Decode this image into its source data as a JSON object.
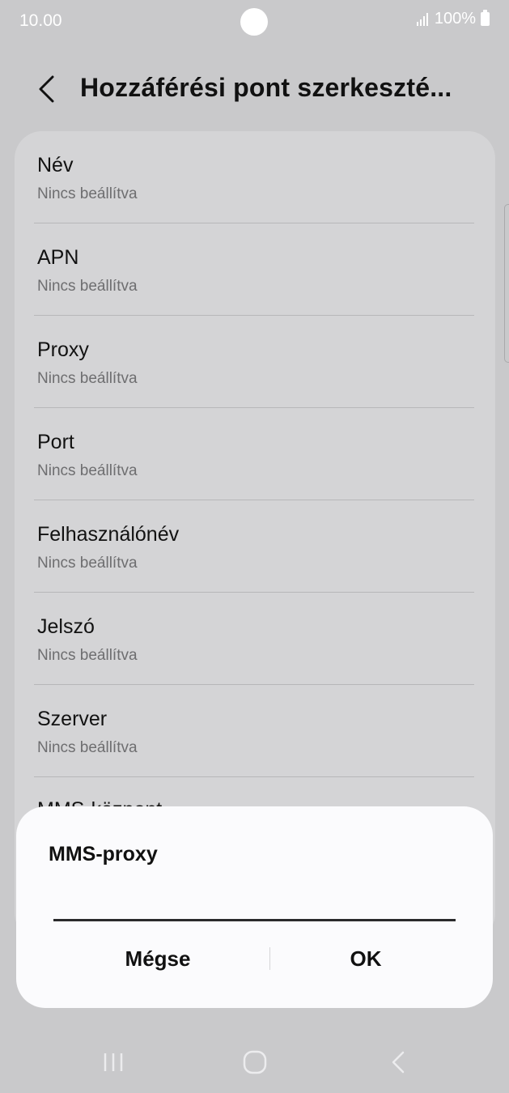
{
  "status_bar": {
    "time": "10.00",
    "battery": "100%",
    "icons": [
      "signal-icon",
      "battery-icon"
    ]
  },
  "header": {
    "back_icon": "chevron-left-icon",
    "title": "Hozzáférési pont szerkeszté..."
  },
  "settings_list": [
    {
      "title": "Név",
      "subtitle": "Nincs beállítva"
    },
    {
      "title": "APN",
      "subtitle": "Nincs beállítva"
    },
    {
      "title": "Proxy",
      "subtitle": "Nincs beállítva"
    },
    {
      "title": "Port",
      "subtitle": "Nincs beállítva"
    },
    {
      "title": "Felhasználónév",
      "subtitle": "Nincs beállítva"
    },
    {
      "title": "Jelszó",
      "subtitle": "Nincs beállítva"
    },
    {
      "title": "Szerver",
      "subtitle": "Nincs beállítva"
    },
    {
      "title": "MMS-központ",
      "subtitle": ""
    }
  ],
  "dialog": {
    "title": "MMS-proxy",
    "input_value": "",
    "cancel_label": "Mégse",
    "ok_label": "OK"
  },
  "nav_bar": {
    "icons": [
      "recents-icon",
      "home-icon",
      "back-icon"
    ]
  },
  "colors": {
    "background": "#c9c9cb",
    "list_card": "#d4d4d6",
    "dialog": "#fbfbfd",
    "secondary_text": "#6e6e70"
  }
}
